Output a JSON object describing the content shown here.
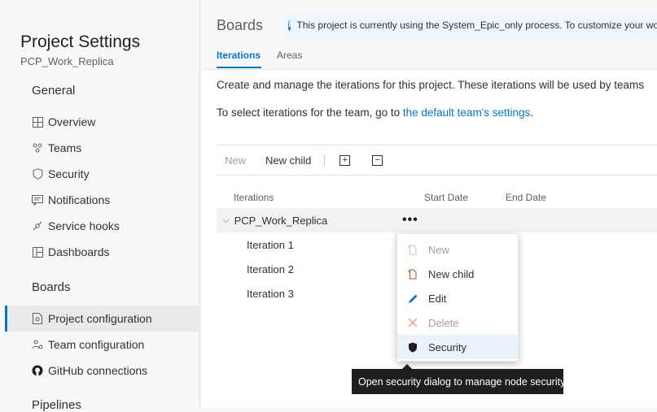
{
  "sidebar": {
    "title": "Project Settings",
    "project": "PCP_Work_Replica",
    "general_heading": "General",
    "general_items": [
      {
        "label": "Overview",
        "icon": "overview-icon"
      },
      {
        "label": "Teams",
        "icon": "teams-icon"
      },
      {
        "label": "Security",
        "icon": "shield-icon"
      },
      {
        "label": "Notifications",
        "icon": "notifications-icon"
      },
      {
        "label": "Service hooks",
        "icon": "service-hooks-icon"
      },
      {
        "label": "Dashboards",
        "icon": "dashboards-icon"
      }
    ],
    "boards_heading": "Boards",
    "boards_items": [
      {
        "label": "Project configuration",
        "icon": "project-configuration-icon",
        "active": true
      },
      {
        "label": "Team configuration",
        "icon": "team-configuration-icon"
      },
      {
        "label": "GitHub connections",
        "icon": "github-icon"
      }
    ],
    "pipelines_heading": "Pipelines"
  },
  "header": {
    "title": "Boards",
    "info_message": "This project is currently using the System_Epic_only process. To customize your work",
    "tabs": [
      {
        "label": "Iterations",
        "active": true
      },
      {
        "label": "Areas",
        "active": false
      }
    ]
  },
  "content": {
    "description": "Create and manage the iterations for this project. These iterations will be used by teams",
    "team_text_prefix": "To select iterations for the team, go to ",
    "team_link": "the default team's settings",
    "team_text_suffix": "."
  },
  "toolbar": {
    "new_label": "New",
    "new_child_label": "New child",
    "expand_symbol": "+",
    "collapse_symbol": "−"
  },
  "table": {
    "columns": [
      "Iterations",
      "Start Date",
      "End Date"
    ],
    "root": "PCP_Work_Replica",
    "more_symbol": "•••",
    "rows": [
      "Iteration 1",
      "Iteration 2",
      "Iteration 3"
    ]
  },
  "context_menu": {
    "items": [
      {
        "label": "New",
        "icon": "new-icon",
        "disabled": true
      },
      {
        "label": "New child",
        "icon": "new-child-icon",
        "disabled": false
      },
      {
        "label": "Edit",
        "icon": "pencil-icon",
        "disabled": false
      },
      {
        "label": "Delete",
        "icon": "delete-icon",
        "disabled": true
      },
      {
        "label": "Security",
        "icon": "shield-icon",
        "disabled": false,
        "highlighted": true
      }
    ]
  },
  "tooltip": {
    "text": "Open security dialog to manage node security"
  },
  "colors": {
    "accent": "#0078d4",
    "delete_disabled": "#e8a7a7",
    "tooltip_bg": "#201f1e"
  }
}
